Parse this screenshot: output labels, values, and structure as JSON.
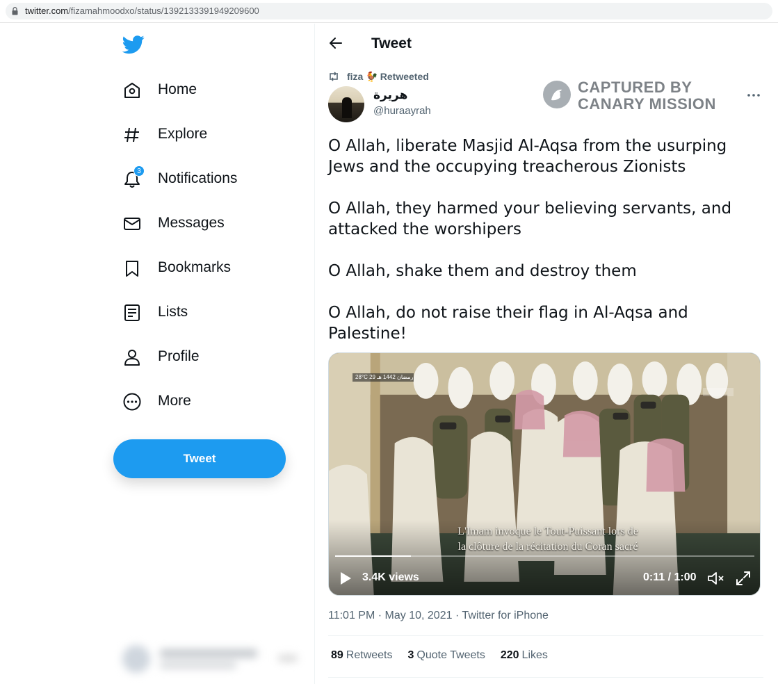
{
  "browser": {
    "url_host": "twitter.com",
    "url_path": "/fizamahmoodxo/status/1392133391949209600"
  },
  "sidebar": {
    "items": [
      {
        "label": "Home",
        "icon": "home-icon"
      },
      {
        "label": "Explore",
        "icon": "hashtag-icon"
      },
      {
        "label": "Notifications",
        "icon": "bell-icon",
        "badge": "3"
      },
      {
        "label": "Messages",
        "icon": "envelope-icon"
      },
      {
        "label": "Bookmarks",
        "icon": "bookmark-icon"
      },
      {
        "label": "Lists",
        "icon": "list-icon"
      },
      {
        "label": "Profile",
        "icon": "person-icon"
      },
      {
        "label": "More",
        "icon": "more-circle-icon"
      }
    ],
    "tweet_button": "Tweet"
  },
  "header": {
    "title": "Tweet"
  },
  "retweet": {
    "name": "fiza",
    "emoji": "🐓",
    "label": "Retweeted"
  },
  "author": {
    "name": "هريرة",
    "handle": "@huraayrah"
  },
  "watermark": {
    "line1": "CAPTURED BY",
    "line2": "CANARY MISSION"
  },
  "tweet": {
    "paragraphs": [
      "O Allah, liberate Masjid Al-Aqsa from the usurping Jews and the occupying treacherous Zionists",
      "O Allah, they harmed your believing servants, and attacked the worshipers",
      "O Allah, shake them and destroy them",
      "O Allah, do not raise their flag in Al-Aqsa and Palestine!"
    ]
  },
  "video": {
    "subtitle_line1": "L'Imam invoque le Tout-Puissant lors de",
    "subtitle_line2": "la clôture de la récitation du Coran sacré",
    "views": "3.4K views",
    "time": "0:11 / 1:00",
    "progress": 0.18,
    "badge": "28°C  29 رمضان 1442 هـ"
  },
  "meta": {
    "time": "11:01 PM",
    "date": "May 10, 2021",
    "source": "Twitter for iPhone",
    "separator": "·"
  },
  "stats": {
    "retweets_count": "89",
    "retweets_label": "Retweets",
    "quotes_count": "3",
    "quotes_label": "Quote Tweets",
    "likes_count": "220",
    "likes_label": "Likes"
  },
  "colors": {
    "accent": "#1d9bf0",
    "text": "#0f1419",
    "secondary": "#536471"
  }
}
